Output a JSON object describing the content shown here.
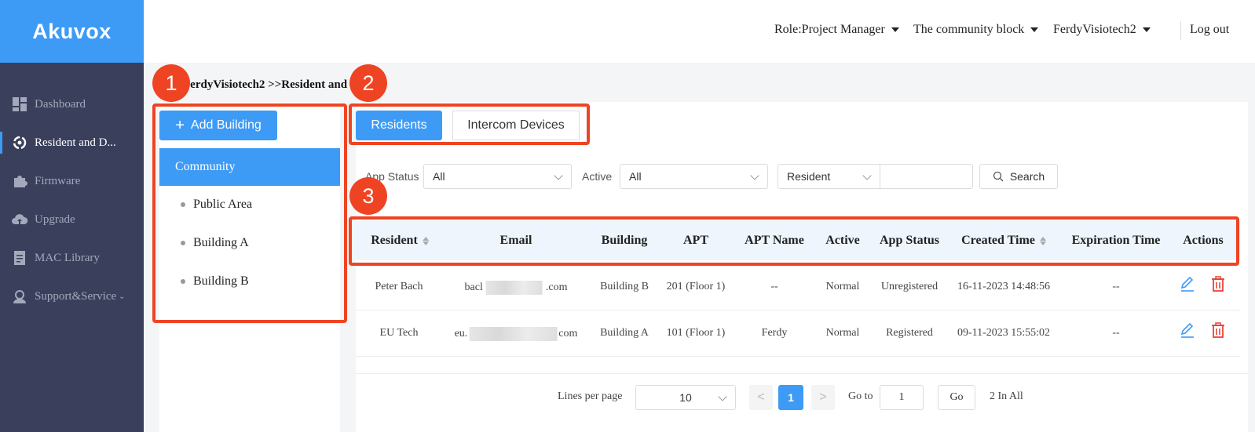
{
  "brand": {
    "logo": "Akuvox",
    "color": "#3d9bf5"
  },
  "header": {
    "role": "Role:Project Manager",
    "community": "The community block",
    "user": "FerdyVisiotech2",
    "logout": "Log out"
  },
  "sidebar": {
    "items": [
      {
        "label": "Dashboard",
        "icon": "dashboard-icon"
      },
      {
        "label": "Resident and D...",
        "icon": "resident-icon",
        "active": true
      },
      {
        "label": "Firmware",
        "icon": "puzzle-icon"
      },
      {
        "label": "Upgrade",
        "icon": "cloud-upload-icon"
      },
      {
        "label": "MAC Library",
        "icon": "document-icon"
      },
      {
        "label": "Support&Service",
        "icon": "support-icon"
      }
    ]
  },
  "breadcrumb": "FerdyVisiotech2 >>Resident and Devices",
  "tree": {
    "add_button": "Add Building",
    "root": "Community",
    "children": [
      "Public Area",
      "Building A",
      "Building B"
    ]
  },
  "tabs": [
    "Residents",
    "Intercom Devices"
  ],
  "filters": {
    "app_status_label": "App Status",
    "app_status_value": "All",
    "active_label": "Active",
    "active_value": "All",
    "search_field_value": "Resident",
    "search_text": "",
    "search_button": "Search"
  },
  "table": {
    "headers": [
      "Resident",
      "Email",
      "Building",
      "APT",
      "APT Name",
      "Active",
      "App Status",
      "Created Time",
      "Expiration Time",
      "Actions"
    ],
    "rows": [
      {
        "resident": "Peter Bach",
        "email_start": "bacl",
        "email_end": ".com",
        "building": "Building B",
        "apt": "201 (Floor 1)",
        "apt_name": "--",
        "active": "Normal",
        "app_status": "Unregistered",
        "created": "16-11-2023 14:48:56",
        "expiration": "--"
      },
      {
        "resident": "EU Tech",
        "email_start": "eu.",
        "email_end": "com",
        "building": "Building A",
        "apt": "101 (Floor 1)",
        "apt_name": "Ferdy",
        "active": "Normal",
        "app_status": "Registered",
        "created": "09-11-2023 15:55:02",
        "expiration": "--"
      }
    ]
  },
  "pagination": {
    "lines_label": "Lines per page",
    "lines_value": "10",
    "prev": "<",
    "current_page": "1",
    "next": ">",
    "goto_label": "Go to",
    "goto_value": "1",
    "go_button": "Go",
    "total": "2 In All"
  },
  "annotations": [
    "1",
    "2",
    "3"
  ],
  "colors": {
    "annotation": "#ee4423",
    "sidebar_bg": "#3a3f5c",
    "delete": "#e8433a"
  }
}
